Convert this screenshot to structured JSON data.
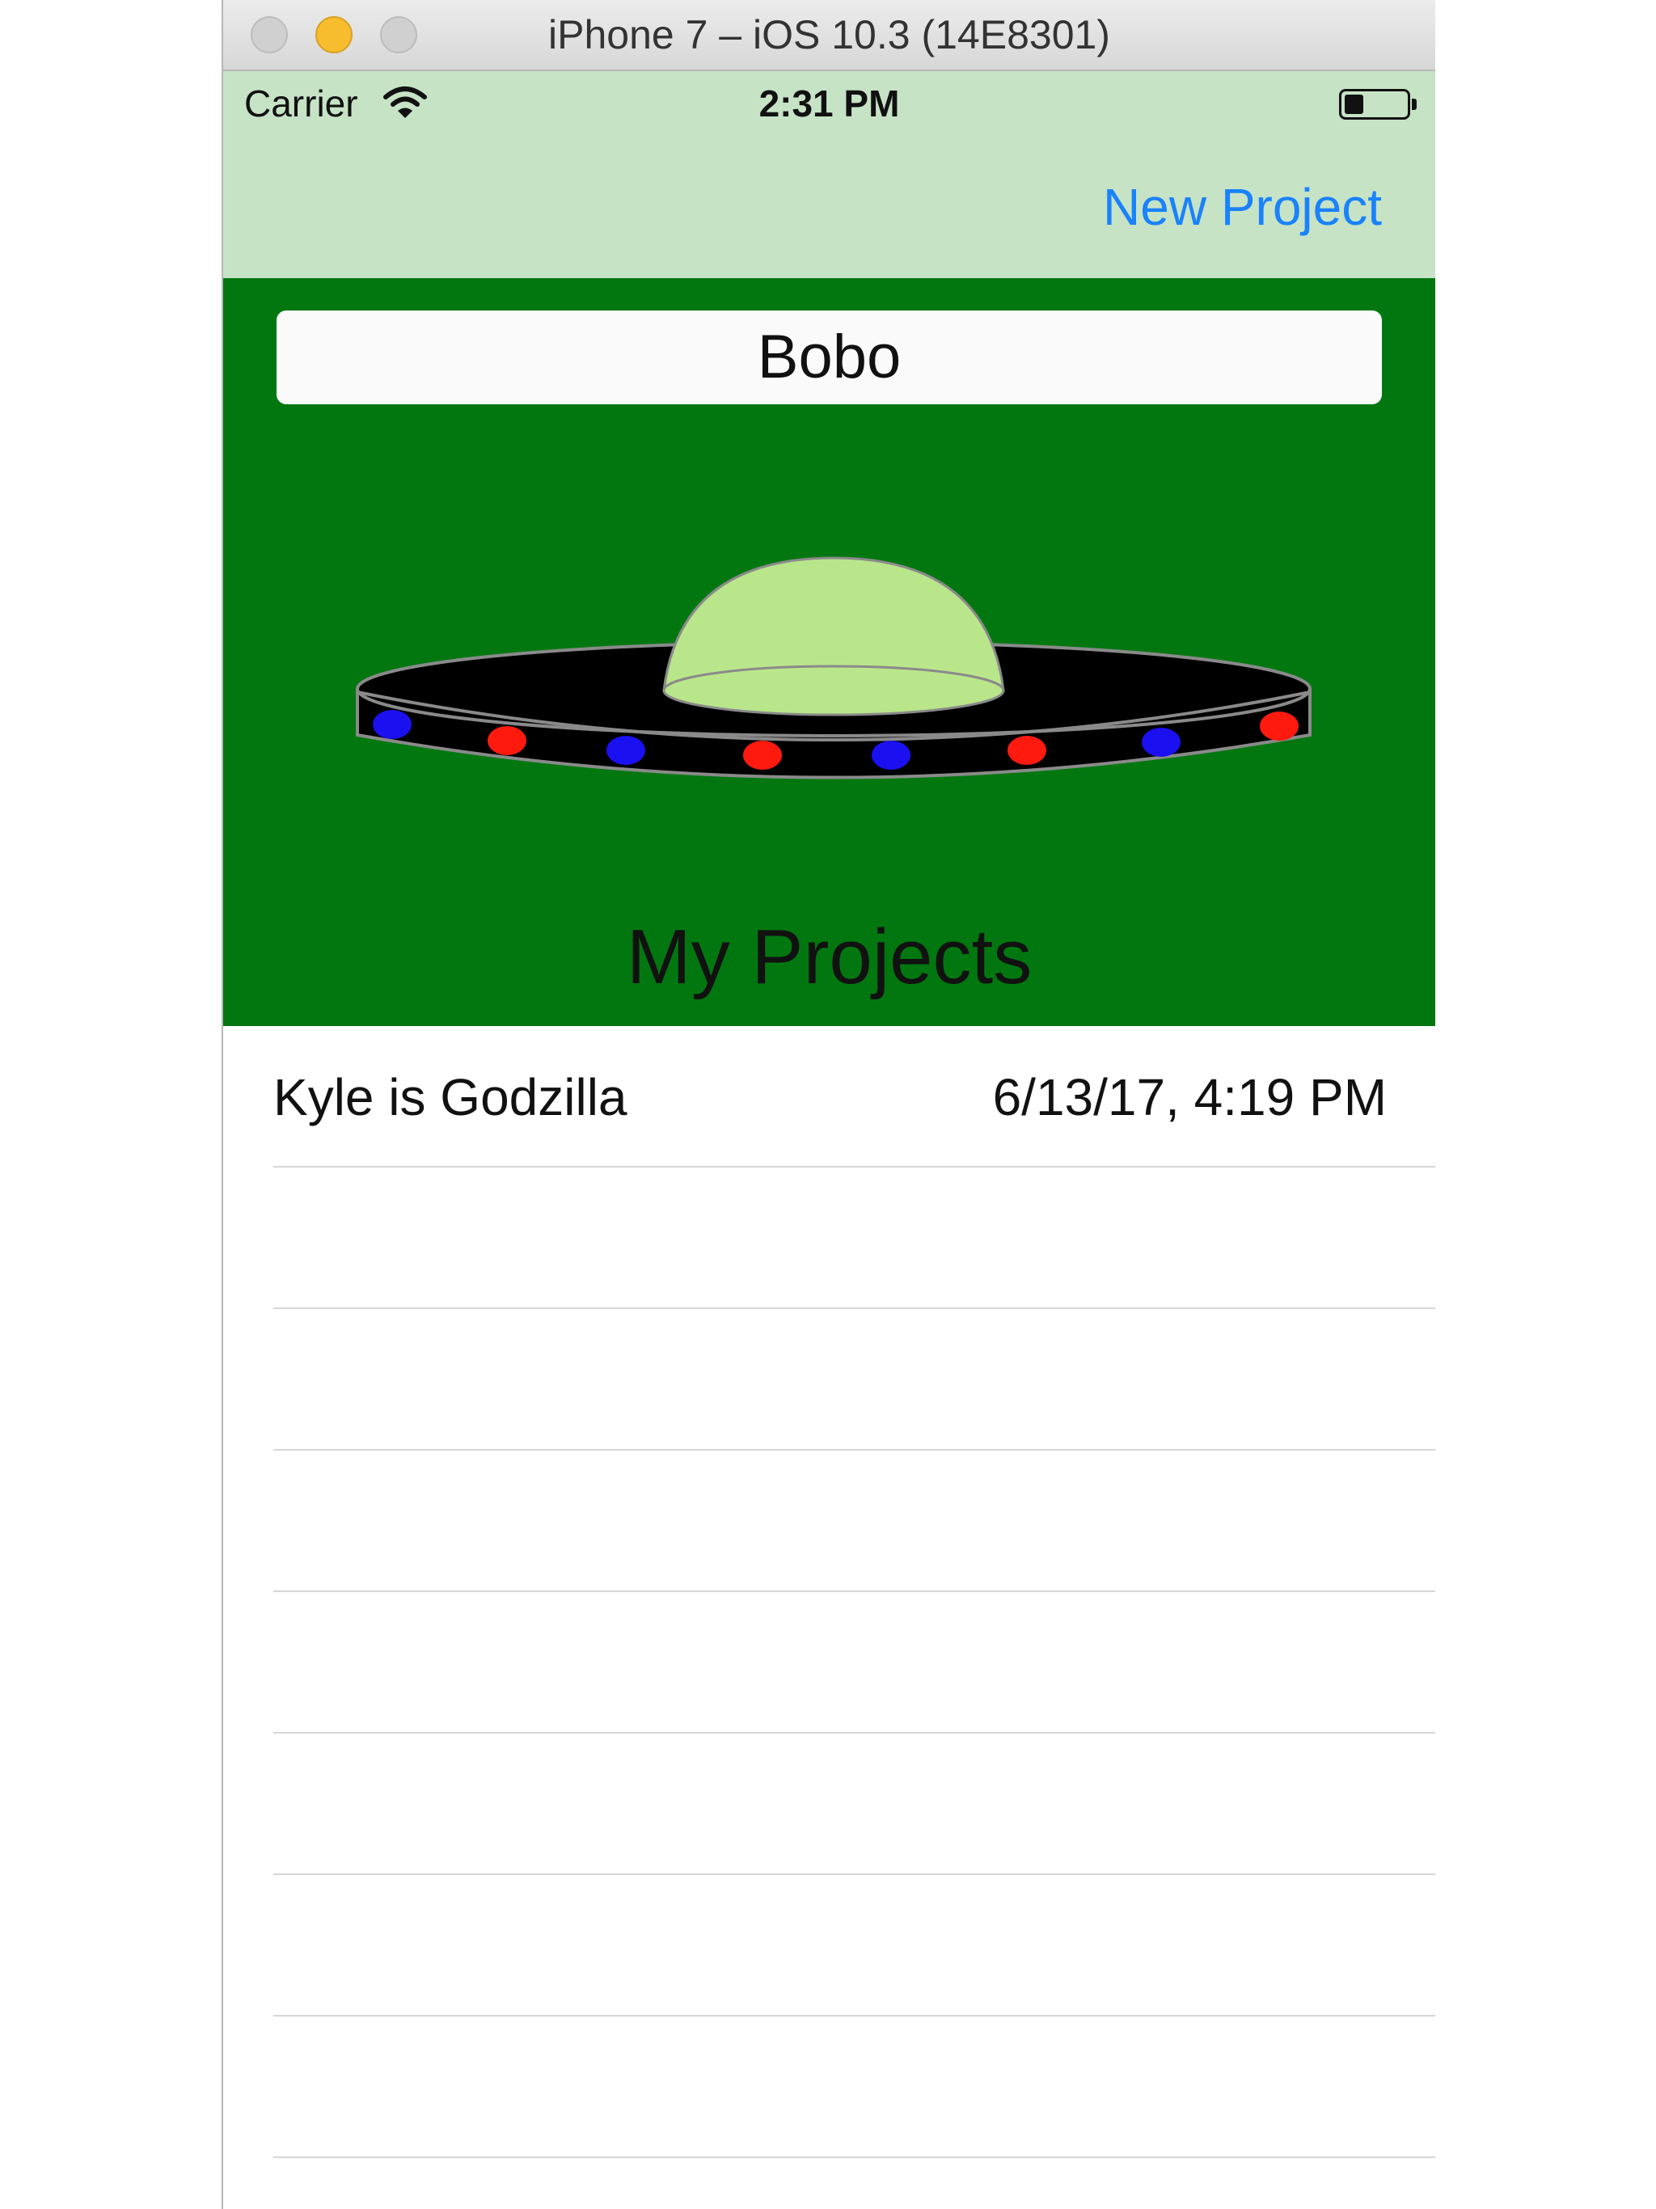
{
  "window": {
    "title": "iPhone 7 – iOS 10.3 (14E8301)"
  },
  "status_bar": {
    "carrier": "Carrier",
    "time": "2:31 PM",
    "wifi_icon": "wifi-icon",
    "battery_icon": "battery-icon",
    "battery_level": 0.3
  },
  "nav": {
    "new_project_label": "New Project"
  },
  "header": {
    "name_value": "Bobo",
    "illustration": "ufo-icon",
    "section_title": "My Projects"
  },
  "colors": {
    "nav_background": "#c6e3c6",
    "header_background": "#027710",
    "accent": "#1a82fb",
    "ufo_dome": "#b9e68a",
    "light_blue": "#1a10f0",
    "light_red": "#ff1a10"
  },
  "projects": [
    {
      "title": "Kyle is Godzilla",
      "date": "6/13/17, 4:19 PM"
    },
    {
      "title": "",
      "date": ""
    },
    {
      "title": "",
      "date": ""
    },
    {
      "title": "",
      "date": ""
    },
    {
      "title": "",
      "date": ""
    },
    {
      "title": "",
      "date": ""
    },
    {
      "title": "",
      "date": ""
    },
    {
      "title": "",
      "date": ""
    }
  ]
}
